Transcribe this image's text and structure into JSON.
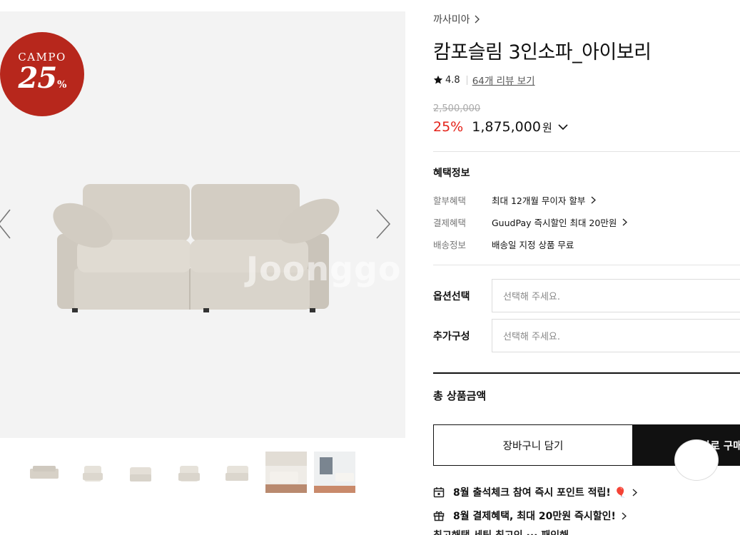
{
  "gallery": {
    "badge_brand": "CAMPO",
    "badge_value": "25",
    "badge_percent": "%",
    "watermark": "Joonggo",
    "thumbnail_count": 7
  },
  "product": {
    "brand": "까사미아",
    "title": "캄포슬림 3인소파_아이보리",
    "rating": "4.8",
    "reviews_link": "64개 리뷰 보기",
    "original_price": "2,500,000",
    "discount": "25%",
    "price": "1,875,000",
    "price_unit": "원"
  },
  "benefits": {
    "title": "혜택정보",
    "items": [
      {
        "label": "할부혜택",
        "value": "최대 12개월 무이자 할부",
        "has_link": true
      },
      {
        "label": "결제혜택",
        "value": "GuudPay 즉시할인 최대 20만원",
        "has_link": true
      },
      {
        "label": "배송정보",
        "value": "배송일 지정 상품 무료",
        "has_link": false
      }
    ]
  },
  "options": [
    {
      "label": "옵션선택",
      "placeholder": "선택해 주세요."
    },
    {
      "label": "추가구성",
      "placeholder": "선택해 주세요."
    }
  ],
  "total": {
    "label": "총 상품금액"
  },
  "actions": {
    "cart": "장바구니 담기",
    "buy": "바로 구매"
  },
  "promos": [
    {
      "icon": "calendar-icon",
      "text": "8월 출석체크 참여 즉시 포인트 적립! 🎈"
    },
    {
      "icon": "gift-icon",
      "text": "8월 결제혜택, 최대 20만원 즉시할인!"
    }
  ],
  "promo_partial": "최고해택 세팅 최고인 ··· 패인해",
  "colors": {
    "badge": "#b7271c",
    "discount": "#e4231a",
    "buy_button": "#111111"
  }
}
